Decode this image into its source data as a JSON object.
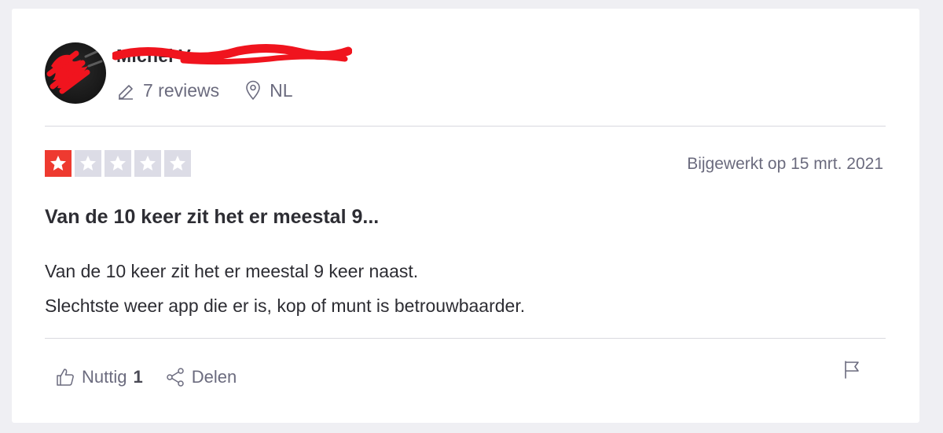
{
  "reviewer": {
    "name": "Michel V",
    "reviews_count": "7 reviews",
    "country": "NL"
  },
  "review": {
    "rating": 1,
    "rating_max": 5,
    "date": "Bijgewerkt op 15 mrt. 2021",
    "title": "Van de 10 keer zit het er meestal 9...",
    "body_lines": [
      "Van de 10 keer zit het er meestal 9 keer naast.",
      "Slechtste weer app die er is, kop of munt is betrouwbaarder."
    ]
  },
  "actions": {
    "useful_label": "Nuttig",
    "useful_count": "1",
    "share_label": "Delen"
  },
  "icons": {
    "avatar": "avatar",
    "reviews": "pencil-icon",
    "location": "location-pin-icon",
    "useful": "thumbs-up-icon",
    "share": "share-icon",
    "flag": "flag-icon"
  },
  "colors": {
    "star_active": "#ee3a30",
    "star_inactive": "#dcdce6",
    "redaction": "#f0141e"
  }
}
